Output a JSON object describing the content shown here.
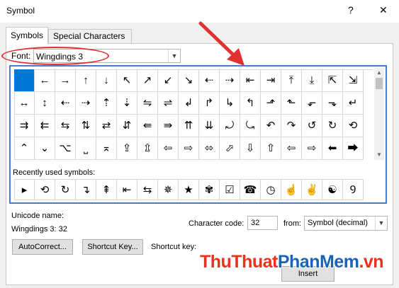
{
  "window": {
    "title": "Symbol",
    "help_label": "?",
    "close_label": "✕"
  },
  "tabs": [
    {
      "label": "Symbols"
    },
    {
      "label": "Special Characters"
    }
  ],
  "font": {
    "label": "Font:",
    "value": "Wingdings 3"
  },
  "symbol_rows": [
    [
      "",
      "←",
      "→",
      "↑",
      "↓",
      "↖",
      "↗",
      "↙",
      "↘",
      "⇠",
      "⇢",
      "⇤",
      "⇥",
      "⤒",
      "⤓",
      "⇱",
      "⇲",
      "⇞",
      "⇟"
    ],
    [
      "↔",
      "↕",
      "⇠",
      "⇢",
      "⇡",
      "⇣",
      "⇋",
      "⇌",
      "↲",
      "↱",
      "↳",
      "↰",
      "⬏",
      "⬑",
      "⬐",
      "⬎",
      "↵",
      "⤷"
    ],
    [
      "⇉",
      "⇇",
      "⇆",
      "⇅",
      "⇄",
      "⇵",
      "⇚",
      "⇛",
      "⇈",
      "⇊",
      "⤾",
      "⤿",
      "↶",
      "↷",
      "↺",
      "↻",
      "⟲",
      "⟳"
    ],
    [
      "⌃",
      "⌄",
      "⌥",
      "⎵",
      "⌅",
      "⇪",
      "⇫",
      "⇦",
      "⇨",
      "⬄",
      "⬀",
      "⇩",
      "⇧",
      "⇦",
      "⇨",
      "⬅",
      "⮕",
      "⇐"
    ]
  ],
  "recent": {
    "label": "Recently used symbols:",
    "symbols": [
      "▸",
      "⟲",
      "↻",
      "↴",
      "⇞",
      "⇤",
      "⇆",
      "✵",
      "★",
      "✾",
      "☑",
      "☎",
      "◷",
      "☝",
      "✌",
      "☯",
      "Ꝯ"
    ]
  },
  "unicode": {
    "name_label": "Unicode name:",
    "value": "Wingdings 3: 32"
  },
  "character_code": {
    "label": "Character code:",
    "value": "32"
  },
  "from": {
    "label": "from:",
    "value": "Symbol (decimal)"
  },
  "buttons": {
    "autocorrect": "AutoCorrect...",
    "shortcut_key": "Shortcut Key...",
    "insert": "Insert"
  },
  "shortcut_key_label": "Shortcut key:",
  "watermark": {
    "part1": "ThuThuat",
    "part2": "PhanMem",
    "part3": ".vn"
  },
  "colors": {
    "selected": "#0078d7",
    "highlight_border": "#4a7ad0",
    "annotation": "#e03030"
  }
}
